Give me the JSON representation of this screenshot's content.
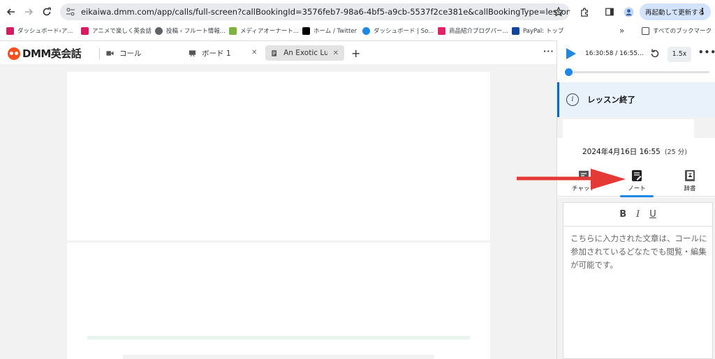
{
  "browser": {
    "url": "eikaiwa.dmm.com/app/calls/full-screen?callBookingId=3576feb7-98a6-4bf5-a9cb-5537f2ce381e&callBookingType=lesson",
    "update_label": "再起動して更新する"
  },
  "bookmarks": {
    "items": [
      {
        "label": "ダッシュボード‹ア...",
        "color": "#d81b60"
      },
      {
        "label": "アニメで楽しく英会話",
        "color": "#d81b60"
      },
      {
        "label": "投稿 ‹ フルート情報...",
        "color": "#5f6368"
      },
      {
        "label": "メディアオーナート...",
        "color": "#7cb342"
      },
      {
        "label": "ホーム / Twitter",
        "color": "#000000"
      },
      {
        "label": "ダッシュボード | So...",
        "color": "#1e88e5"
      },
      {
        "label": "商品紹介ブログパー...",
        "color": "#e91e63"
      },
      {
        "label": "PayPal: トップ",
        "color": "#0d47a1"
      }
    ],
    "overflow": "»",
    "all_label": "すべてのブックマーク"
  },
  "app": {
    "logo_text": "DMM英会話",
    "tab_call": "コール",
    "tab_board": "ボード 1",
    "tab_doc": "An Exotic Lur",
    "add": "+",
    "more": "···"
  },
  "panel": {
    "time": "16:30:58 / 16:55...",
    "speed": "1.5x",
    "progress": 0.0,
    "notice": "レッスン終了",
    "date": "2024年4月16日 16:55",
    "duration": "(25 分)",
    "tabs": [
      {
        "label": "チャット",
        "icon": "chat-icon"
      },
      {
        "label": "ノート",
        "icon": "note-icon"
      },
      {
        "label": "辞書",
        "icon": "dictionary-icon"
      }
    ],
    "format": {
      "bold": "B",
      "italic": "I",
      "underline": "U"
    },
    "note_text": "こちらに入力された文章は、コールに参加されているどなたでも閲覧・編集が可能です。"
  },
  "colors": {
    "accent": "#1e88e5",
    "arrow": "#e53935",
    "brand": "#f4511e"
  }
}
